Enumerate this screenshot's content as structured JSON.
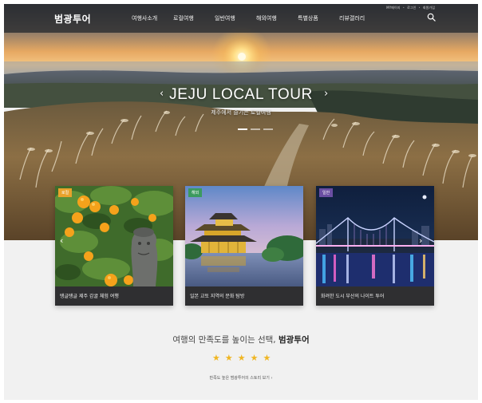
{
  "brand": {
    "logo": "범광투어"
  },
  "header": {
    "util": [
      "MY메이지",
      "로그인",
      "회원가입"
    ],
    "nav": [
      "여행사소개",
      "로컬여행",
      "일반여행",
      "해외여행",
      "특별상품",
      "리뷰갤러리"
    ]
  },
  "hero": {
    "title": "JEJU LOCAL TOUR",
    "subtitle": "제주에서 즐기는 로컬여행",
    "prev": "‹",
    "next": "›",
    "slides": 3,
    "active_slide": 1
  },
  "cards": [
    {
      "tag": "로컬",
      "tag_color": "#e9a22b",
      "caption": "탱글탱글 제주 감귤 체험 여행"
    },
    {
      "tag": "해외",
      "tag_color": "#3c9a5f",
      "caption": "일본 교토 지역의 문화 탐방"
    },
    {
      "tag": "일반",
      "tag_color": "#6a4ea2",
      "caption": "화려한 도시 부산의 나이트 투어"
    }
  ],
  "card_nav": {
    "prev": "‹",
    "next": "›"
  },
  "promo": {
    "tagline_prefix": "여행의 만족도를 높이는 선택, ",
    "tagline_brand": "범광투어",
    "rating": 5,
    "more": "만족도 높은 범광투어의 스토리 보기  ›"
  },
  "icons": {
    "search": "search-icon",
    "star": "star-icon"
  },
  "colors": {
    "header_bg": "#2a2c2e",
    "star": "#f0b623",
    "card_bg": "#2f2f31"
  }
}
